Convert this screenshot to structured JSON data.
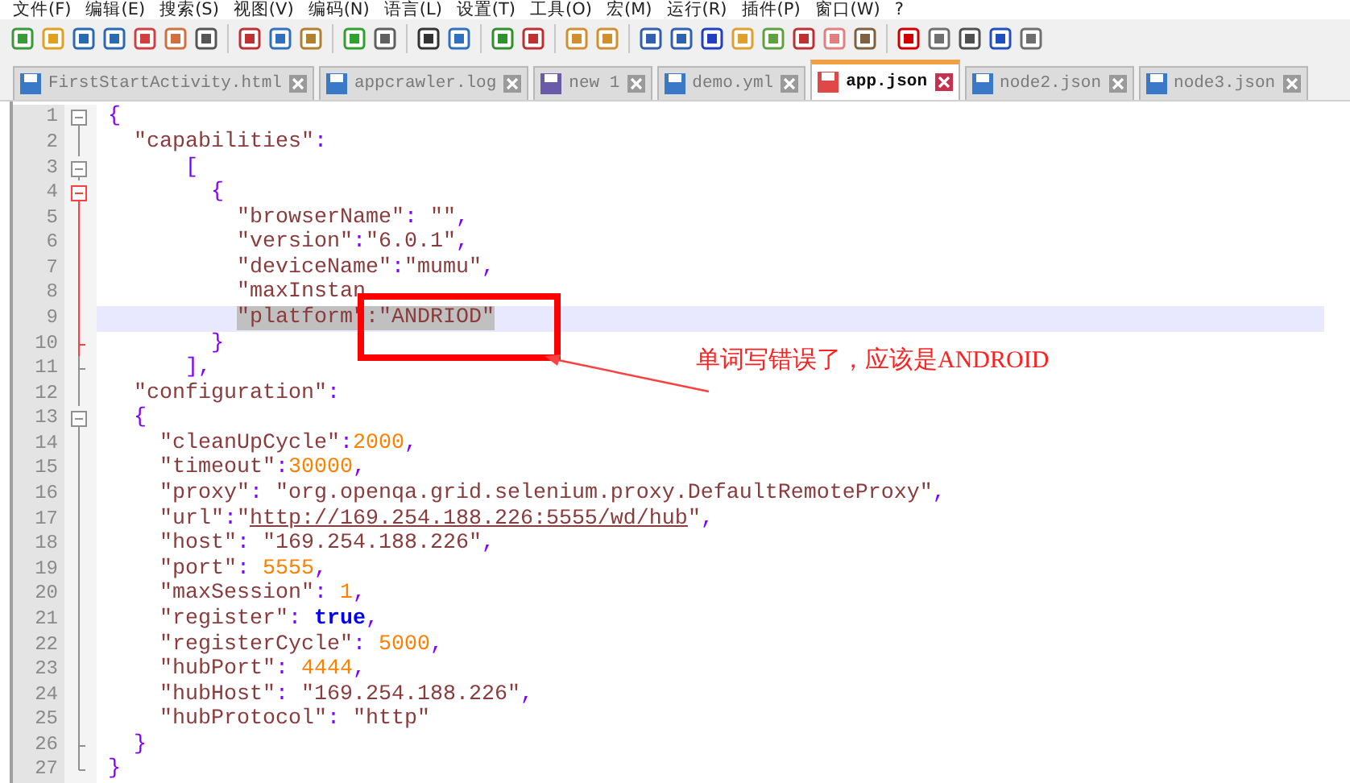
{
  "menu": [
    "文件(F)",
    "编辑(E)",
    "搜索(S)",
    "视图(V)",
    "编码(N)",
    "语言(L)",
    "设置(T)",
    "工具(O)",
    "宏(M)",
    "运行(R)",
    "插件(P)",
    "窗口(W)",
    "?"
  ],
  "tabs": [
    {
      "label": "FirstStartActivity.html",
      "selected": false,
      "kind": "saved"
    },
    {
      "label": "appcrawler.log",
      "selected": false,
      "kind": "saved"
    },
    {
      "label": "new 1",
      "selected": false,
      "kind": "new"
    },
    {
      "label": "demo.yml",
      "selected": false,
      "kind": "saved"
    },
    {
      "label": "app.json",
      "selected": true,
      "kind": "modified"
    },
    {
      "label": "node2.json",
      "selected": false,
      "kind": "saved"
    },
    {
      "label": "node3.json",
      "selected": false,
      "kind": "saved"
    }
  ],
  "editor": {
    "lines": [
      {
        "number": "1",
        "current": false,
        "tokens": [
          {
            "kind": "punct",
            "text": "{"
          }
        ]
      },
      {
        "number": "2",
        "current": false,
        "tokens": [
          {
            "kind": "string",
            "text": "  \"capabilities\""
          },
          {
            "kind": "punct",
            "text": ":"
          }
        ]
      },
      {
        "number": "3",
        "current": false,
        "tokens": [
          {
            "kind": "punct",
            "text": "      ["
          }
        ]
      },
      {
        "number": "4",
        "current": false,
        "tokens": [
          {
            "kind": "punct",
            "text": "        {"
          }
        ]
      },
      {
        "number": "5",
        "current": false,
        "tokens": [
          {
            "kind": "string",
            "text": "          \"browserName\""
          },
          {
            "kind": "punct",
            "text": ":"
          },
          {
            "kind": "string",
            "text": " \"\""
          },
          {
            "kind": "punct",
            "text": ","
          }
        ]
      },
      {
        "number": "6",
        "current": false,
        "tokens": [
          {
            "kind": "string",
            "text": "          \"version\""
          },
          {
            "kind": "punct",
            "text": ":"
          },
          {
            "kind": "string",
            "text": "\"6.0.1\""
          },
          {
            "kind": "punct",
            "text": ","
          }
        ]
      },
      {
        "number": "7",
        "current": false,
        "tokens": [
          {
            "kind": "string",
            "text": "          \"deviceName\""
          },
          {
            "kind": "punct",
            "text": ":"
          },
          {
            "kind": "string",
            "text": "\"mumu\""
          },
          {
            "kind": "punct",
            "text": ","
          }
        ]
      },
      {
        "number": "8",
        "current": false,
        "tokens": [
          {
            "kind": "string",
            "text": "          \"maxInstan"
          }
        ]
      },
      {
        "number": "9",
        "current": true,
        "tokens": [
          {
            "kind": "selection",
            "text": "\"platform\":\"ANDRIOD\""
          }
        ]
      },
      {
        "number": "10",
        "current": false,
        "tokens": [
          {
            "kind": "punct",
            "text": "        }"
          }
        ]
      },
      {
        "number": "11",
        "current": false,
        "tokens": [
          {
            "kind": "punct",
            "text": "      ],"
          }
        ]
      },
      {
        "number": "12",
        "current": false,
        "tokens": [
          {
            "kind": "string",
            "text": "  \"configuration\""
          },
          {
            "kind": "punct",
            "text": ":"
          }
        ]
      },
      {
        "number": "13",
        "current": false,
        "tokens": [
          {
            "kind": "punct",
            "text": "  {"
          }
        ]
      },
      {
        "number": "14",
        "current": false,
        "tokens": [
          {
            "kind": "string",
            "text": "    \"cleanUpCycle\""
          },
          {
            "kind": "punct",
            "text": ":"
          },
          {
            "kind": "number",
            "text": "2000"
          },
          {
            "kind": "punct",
            "text": ","
          }
        ]
      },
      {
        "number": "15",
        "current": false,
        "tokens": [
          {
            "kind": "string",
            "text": "    \"timeout\""
          },
          {
            "kind": "punct",
            "text": ":"
          },
          {
            "kind": "number",
            "text": "30000"
          },
          {
            "kind": "punct",
            "text": ","
          }
        ]
      },
      {
        "number": "16",
        "current": false,
        "tokens": [
          {
            "kind": "string",
            "text": "    \"proxy\""
          },
          {
            "kind": "punct",
            "text": ": "
          },
          {
            "kind": "string",
            "text": "\"org.openqa.grid.selenium.proxy.DefaultRemoteProxy\""
          },
          {
            "kind": "punct",
            "text": ","
          }
        ]
      },
      {
        "number": "17",
        "current": false,
        "tokens": [
          {
            "kind": "string",
            "text": "    \"url\""
          },
          {
            "kind": "punct",
            "text": ":"
          },
          {
            "kind": "string",
            "text": "\""
          },
          {
            "kind": "link",
            "text": "http://169.254.188.226:5555/wd/hub"
          },
          {
            "kind": "string",
            "text": "\""
          },
          {
            "kind": "punct",
            "text": ","
          }
        ]
      },
      {
        "number": "18",
        "current": false,
        "tokens": [
          {
            "kind": "string",
            "text": "    \"host\""
          },
          {
            "kind": "punct",
            "text": ": "
          },
          {
            "kind": "string",
            "text": "\"169.254.188.226\""
          },
          {
            "kind": "punct",
            "text": ","
          }
        ]
      },
      {
        "number": "19",
        "current": false,
        "tokens": [
          {
            "kind": "string",
            "text": "    \"port\""
          },
          {
            "kind": "punct",
            "text": ": "
          },
          {
            "kind": "number",
            "text": "5555"
          },
          {
            "kind": "punct",
            "text": ","
          }
        ]
      },
      {
        "number": "20",
        "current": false,
        "tokens": [
          {
            "kind": "string",
            "text": "    \"maxSession\""
          },
          {
            "kind": "punct",
            "text": ": "
          },
          {
            "kind": "number",
            "text": "1"
          },
          {
            "kind": "punct",
            "text": ","
          }
        ]
      },
      {
        "number": "21",
        "current": false,
        "tokens": [
          {
            "kind": "string",
            "text": "    \"register\""
          },
          {
            "kind": "punct",
            "text": ": "
          },
          {
            "kind": "keyword",
            "text": "true"
          },
          {
            "kind": "punct",
            "text": ","
          }
        ]
      },
      {
        "number": "22",
        "current": false,
        "tokens": [
          {
            "kind": "string",
            "text": "    \"registerCycle\""
          },
          {
            "kind": "punct",
            "text": ": "
          },
          {
            "kind": "number",
            "text": "5000"
          },
          {
            "kind": "punct",
            "text": ","
          }
        ]
      },
      {
        "number": "23",
        "current": false,
        "tokens": [
          {
            "kind": "string",
            "text": "    \"hubPort\""
          },
          {
            "kind": "punct",
            "text": ": "
          },
          {
            "kind": "number",
            "text": "4444"
          },
          {
            "kind": "punct",
            "text": ","
          }
        ]
      },
      {
        "number": "24",
        "current": false,
        "tokens": [
          {
            "kind": "string",
            "text": "    \"hubHost\""
          },
          {
            "kind": "punct",
            "text": ": "
          },
          {
            "kind": "string",
            "text": "\"169.254.188.226\""
          },
          {
            "kind": "punct",
            "text": ","
          }
        ]
      },
      {
        "number": "25",
        "current": false,
        "tokens": [
          {
            "kind": "string",
            "text": "    \"hubProtocol\""
          },
          {
            "kind": "punct",
            "text": ": "
          },
          {
            "kind": "string",
            "text": "\"http\""
          }
        ]
      },
      {
        "number": "26",
        "current": false,
        "tokens": [
          {
            "kind": "punct",
            "text": "  }"
          }
        ]
      },
      {
        "number": "27",
        "current": false,
        "tokens": [
          {
            "kind": "punct",
            "text": "}"
          }
        ]
      }
    ]
  },
  "annotation": {
    "text": "单词写错误了，应该是ANDROID"
  }
}
